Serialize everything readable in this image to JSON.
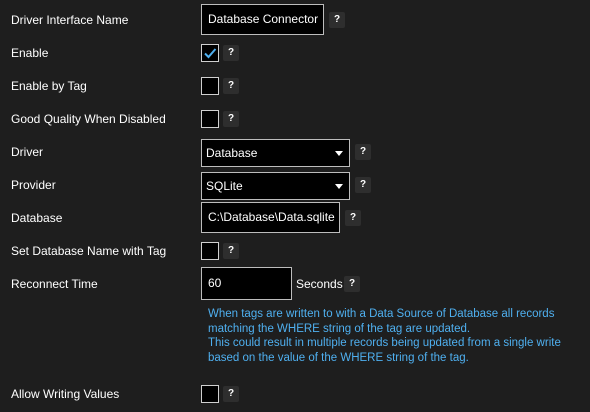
{
  "fields": {
    "driver_interface_name": {
      "label": "Driver Interface Name",
      "value": "Database Connector"
    },
    "enable": {
      "label": "Enable",
      "checked": true
    },
    "enable_by_tag": {
      "label": "Enable by Tag",
      "checked": false
    },
    "good_quality": {
      "label": "Good Quality When Disabled",
      "checked": false
    },
    "driver": {
      "label": "Driver",
      "value": "Database"
    },
    "provider": {
      "label": "Provider",
      "value": "SQLite"
    },
    "database": {
      "label": "Database",
      "value": "C:\\Database\\Data.sqlite"
    },
    "set_db_name_tag": {
      "label": "Set Database Name with Tag",
      "checked": false
    },
    "reconnect_time": {
      "label": "Reconnect Time",
      "value": "60",
      "unit": "Seconds"
    },
    "allow_writing": {
      "label": "Allow Writing Values",
      "checked": false
    }
  },
  "help_glyph": "?",
  "info_lines": [
    "When tags are written to with a Data Source of Database all records",
    "matching the WHERE string of the tag are updated.",
    "This could result in multiple records being updated from a single write",
    "based on the value of the WHERE string of the tag."
  ],
  "colors": {
    "background": "#1e1e1e",
    "info_text": "#4fb0f0",
    "check_accent": "#4fb0f0"
  }
}
